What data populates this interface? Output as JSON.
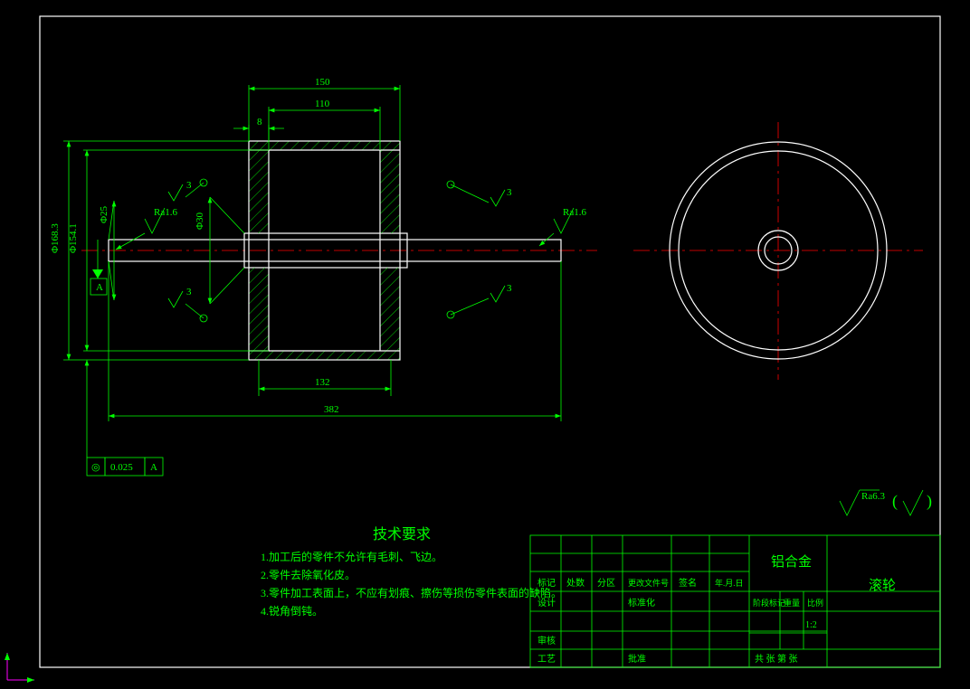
{
  "dims": {
    "d150": "150",
    "d110": "110",
    "d8": "8",
    "d132": "132",
    "d382": "382",
    "phi168": "Φ168.3",
    "phi154": "Φ154.1",
    "phi25": "Φ25",
    "phi30": "Φ30"
  },
  "surf": {
    "ra16_1": "Ra1.6",
    "ra16_2": "Ra1.6",
    "ra63": "Ra6.3"
  },
  "datum": {
    "A": "A"
  },
  "gdt": {
    "conc": "◎",
    "tol": "0.025",
    "ref": "A"
  },
  "leaders": {
    "n3a": "3",
    "n3b": "3",
    "n3c": "3",
    "n3d": "3"
  },
  "notes": {
    "title": "技术要求",
    "l1": "1.加工后的零件不允许有毛刺、飞边。",
    "l2": "2.零件去除氧化皮。",
    "l3": "3.零件加工表面上，不应有划痕、擦伤等损伤零件表面的缺陷。",
    "l4": "4.锐角倒钝。"
  },
  "title_block": {
    "material": "铝合金",
    "part": "滚轮",
    "h_mark": "标记",
    "h_qty": "处数",
    "h_zone": "分区",
    "h_doc": "更改文件号",
    "h_sign": "签名",
    "h_date": "年.月.日",
    "r_design": "设计",
    "r_std": "标准化",
    "r_stage": "阶段标记",
    "r_mass": "重量",
    "r_scale": "比例",
    "r_check": "审核",
    "r_proc": "工艺",
    "r_approve": "批准",
    "scale_val": "1:2",
    "sheets": "共    张  第    张"
  }
}
